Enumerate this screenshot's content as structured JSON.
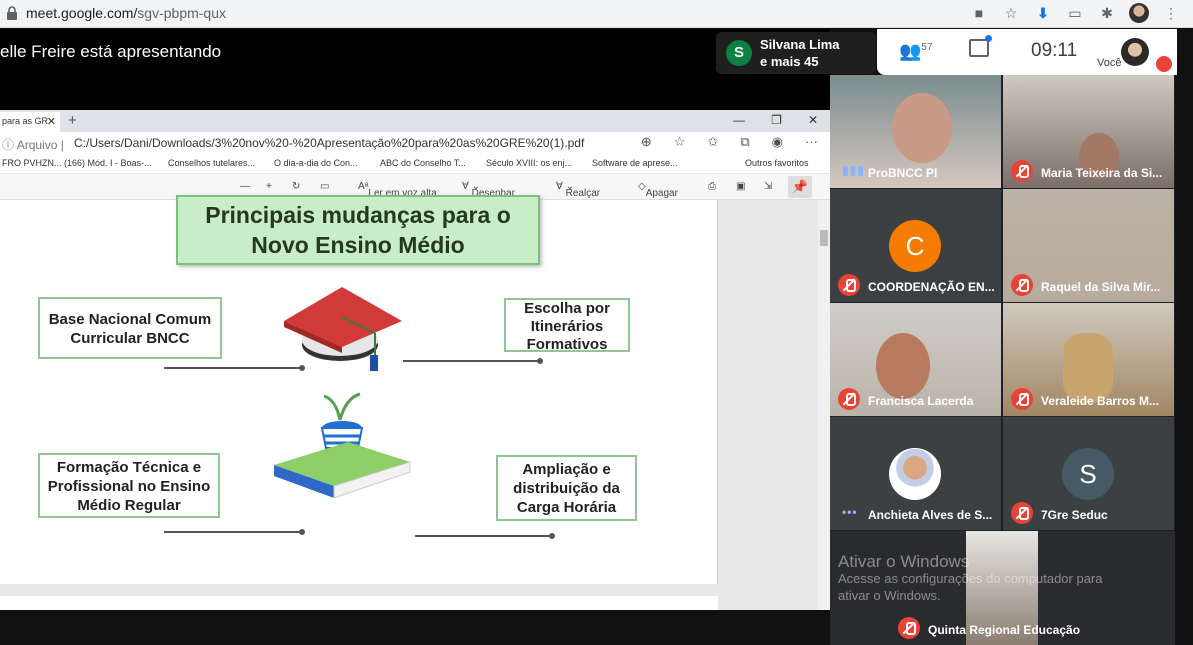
{
  "browser": {
    "url_host": "meet.google.com/",
    "url_path": "sgv-pbpm-qux"
  },
  "meet": {
    "presenting_text": "elle Freire está apresentando",
    "chip_initial": "S",
    "chip_name": "Silvana Lima",
    "chip_more": "e mais 45",
    "people_count": "57",
    "time": "09:11",
    "you_label": "Você"
  },
  "shared": {
    "tab_label": "para as GR",
    "address_prefix": "Arquivo",
    "address_path": "C:/Users/Dani/Downloads/3%20nov%20-%20Apresentação%20para%20as%20GRE%20(1).pdf",
    "favorites": [
      "FRO PVHZN...",
      "(166) Mód. I - Boas-...",
      "Conselhos tutelares...",
      "O dia-a-dia do Con...",
      "ABC do Conselho T...",
      "Século XVIII: os enj...",
      "Software de aprese...",
      "Outros favoritos"
    ],
    "toolbar": {
      "read_aloud": "Ler em voz alta",
      "draw": "Desenhar",
      "highlight": "Realçar",
      "erase": "Apagar"
    },
    "slide": {
      "title_line1": "Principais mudanças para o",
      "title_line2": "Novo Ensino Médio",
      "box1": "Base Nacional Comum Curricular BNCC",
      "box2": "Escolha por Itinerários Formativos",
      "box3": "Formação Técnica e Profissional no Ensino Médio Regular",
      "box4": "Ampliação e distribuição da Carga Horária"
    }
  },
  "participants": [
    {
      "name": "ProBNCC PI",
      "state": "speaking"
    },
    {
      "name": "Maria Teixeira da Si...",
      "state": "muted"
    },
    {
      "name": "COORDENAÇÃO EN...",
      "state": "muted",
      "initial": "C"
    },
    {
      "name": "Raquel da Silva Mir...",
      "state": "muted"
    },
    {
      "name": "Francisca Lacerda",
      "state": "muted"
    },
    {
      "name": "Veraleide Barros M...",
      "state": "muted"
    },
    {
      "name": "Anchieta Alves de S...",
      "state": "speaking"
    },
    {
      "name": "7Gre Seduc",
      "state": "muted",
      "initial": "S"
    },
    {
      "name": "Quinta Regional Educação",
      "state": "muted"
    }
  ],
  "windows_watermark": {
    "line1": "Ativar o Windows",
    "line2": "Acesse as configurações do computador para",
    "line3": "ativar o Windows."
  },
  "colors": {
    "meet_red": "#ea4335",
    "slide_green": "#c9ecc9",
    "avatar_orange": "#f57c00"
  }
}
